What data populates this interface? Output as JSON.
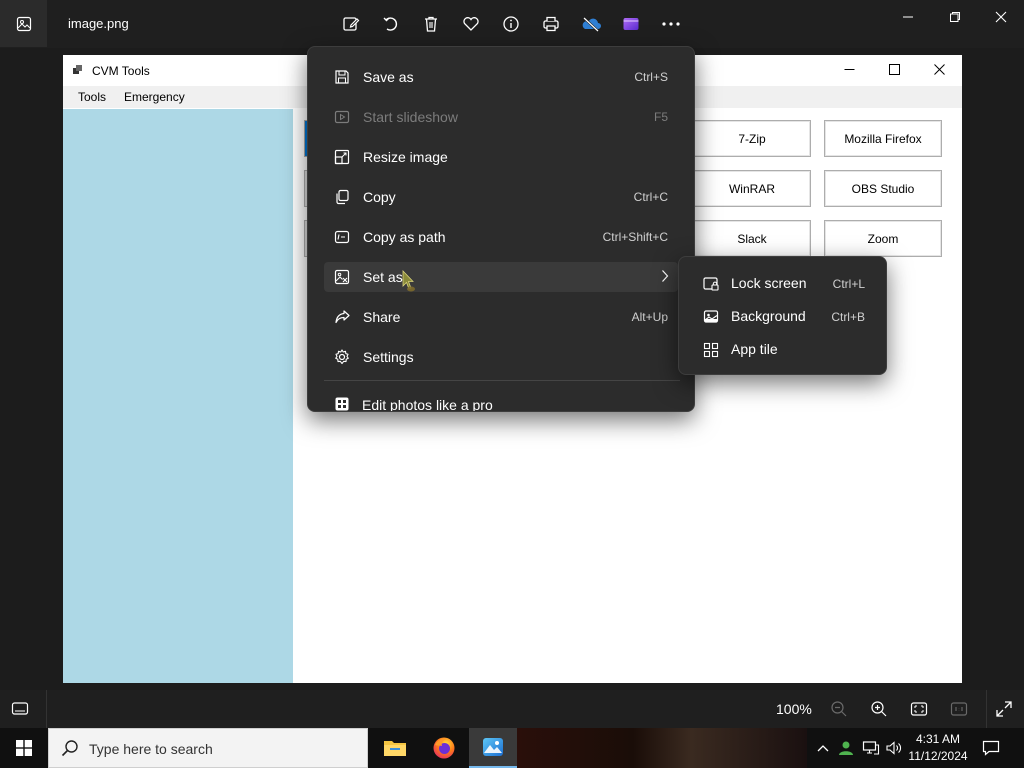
{
  "viewer": {
    "file_name": "image.png",
    "toolbar_icons": [
      "edit-image-icon",
      "rotate-icon",
      "delete-icon",
      "favorite-icon",
      "info-icon",
      "print-icon",
      "onedrive-icon",
      "clipchamp-icon",
      "more-icon"
    ],
    "window_controls": [
      "minimize-icon",
      "maximize-icon",
      "close-icon"
    ],
    "zoom_level": "100%"
  },
  "cvm": {
    "title": "CVM Tools",
    "menu": [
      "Tools",
      "Emergency"
    ],
    "buttons": [
      [
        "7-Zip",
        "Mozilla Firefox"
      ],
      [
        "WinRAR",
        "OBS Studio"
      ],
      [
        "Slack",
        "Zoom"
      ]
    ],
    "sidebar_color": "#add8e6"
  },
  "context_menu": {
    "items": [
      {
        "label": "Save as",
        "shortcut": "Ctrl+S",
        "icon": "save-icon",
        "enabled": true
      },
      {
        "label": "Start slideshow",
        "shortcut": "F5",
        "icon": "slideshow-icon",
        "enabled": false
      },
      {
        "label": "Resize image",
        "shortcut": "",
        "icon": "resize-icon",
        "enabled": true
      },
      {
        "label": "Copy",
        "shortcut": "Ctrl+C",
        "icon": "copy-icon",
        "enabled": true
      },
      {
        "label": "Copy as path",
        "shortcut": "Ctrl+Shift+C",
        "icon": "copy-path-icon",
        "enabled": true
      },
      {
        "label": "Set as",
        "shortcut": "",
        "icon": "set-as-icon",
        "enabled": true,
        "has_submenu": true
      },
      {
        "label": "Share",
        "shortcut": "Alt+Up",
        "icon": "share-icon",
        "enabled": true
      },
      {
        "label": "Settings",
        "shortcut": "",
        "icon": "settings-icon",
        "enabled": true
      }
    ],
    "promo": {
      "label": "Edit photos like a pro",
      "icon": "promo-icon"
    }
  },
  "submenu": {
    "items": [
      {
        "label": "Lock screen",
        "shortcut": "Ctrl+L",
        "icon": "lock-screen-icon"
      },
      {
        "label": "Background",
        "shortcut": "Ctrl+B",
        "icon": "background-icon"
      },
      {
        "label": "App tile",
        "shortcut": "",
        "icon": "app-tile-icon"
      }
    ]
  },
  "taskbar": {
    "search_placeholder": "Type here to search",
    "apps": [
      "file-explorer-icon",
      "firefox-icon",
      "photos-icon"
    ],
    "time": "4:31 AM",
    "date": "11/12/2024"
  },
  "colors": {
    "menu_bg": "#2c2c2c",
    "menu_hover": "#3a3a3a",
    "accent": "#76b9ed"
  }
}
